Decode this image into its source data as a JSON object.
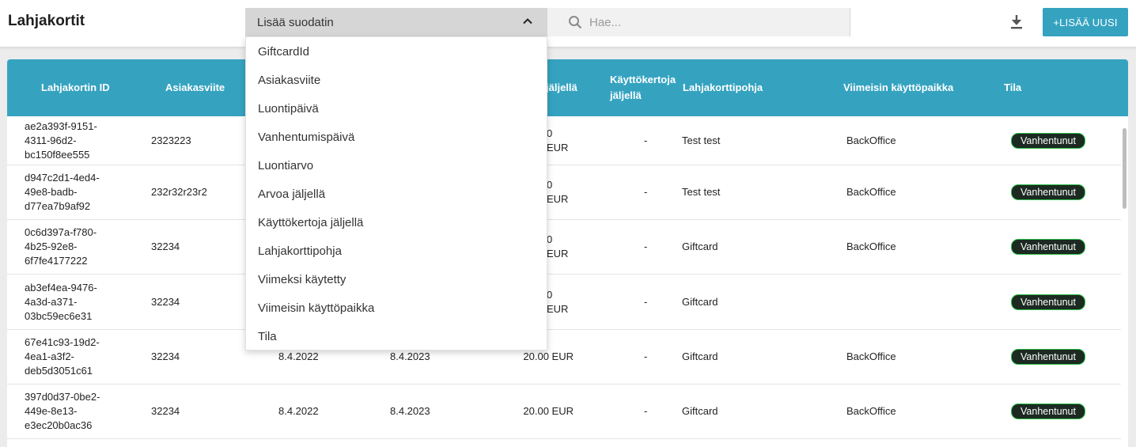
{
  "header": {
    "title": "Lahjakortit",
    "filter_label": "Lisää suodatin",
    "search_placeholder": "Hae...",
    "add_button": "+LISÄÄ UUSI"
  },
  "table": {
    "columns": [
      "Lahjakortin ID",
      "Asiakasviite",
      "",
      "",
      "jäljellä",
      "Käyttökertoja jäljellä",
      "Lahjakorttipohja",
      "Viimeisin käyttöpaikka",
      "Tila"
    ],
    "rows": [
      {
        "id": [
          "ae2a393f-9151-",
          "4311-96d2-",
          "bc150f8ee555"
        ],
        "ref": "2323223",
        "created": "",
        "expires": "",
        "value": "0 EUR",
        "uses": "-",
        "template": "Test test",
        "place": "BackOffice",
        "status": "Vanhentunut"
      },
      {
        "id": [
          "d947c2d1-4ed4-",
          "49e8-badb-",
          "d77ea7b9af92"
        ],
        "ref": "232r32r23r2",
        "created": "",
        "expires": "",
        "value": "0 EUR",
        "uses": "-",
        "template": "Test test",
        "place": "BackOffice",
        "status": "Vanhentunut"
      },
      {
        "id": [
          "0c6d397a-f780-",
          "4b25-92e8-",
          "6f7fe4177222"
        ],
        "ref": "32234",
        "created": "",
        "expires": "",
        "value": "0 EUR",
        "uses": "-",
        "template": "Giftcard",
        "place": "BackOffice",
        "status": "Vanhentunut"
      },
      {
        "id": [
          "ab3ef4ea-9476-",
          "4a3d-a371-",
          "03bc59ec6e31"
        ],
        "ref": "32234",
        "created": "",
        "expires": "",
        "value": "0 EUR",
        "uses": "-",
        "template": "Giftcard",
        "place": "",
        "status": "Vanhentunut"
      },
      {
        "id": [
          "67e41c93-19d2-",
          "4ea1-a3f2-",
          "deb5d3051c61"
        ],
        "ref": "32234",
        "created": "8.4.2022",
        "expires": "8.4.2023",
        "value": "20.00 EUR",
        "uses": "-",
        "template": "Giftcard",
        "place": "BackOffice",
        "status": "Vanhentunut"
      },
      {
        "id": [
          "397d0d37-0be2-",
          "449e-8e13-",
          "e3ec20b0ac36"
        ],
        "ref": "32234",
        "created": "8.4.2022",
        "expires": "8.4.2023",
        "value": "20.00 EUR",
        "uses": "-",
        "template": "Giftcard",
        "place": "BackOffice",
        "status": "Vanhentunut"
      }
    ]
  },
  "dropdown": {
    "items": [
      "GiftcardId",
      "Asiakasviite",
      "Luontipäivä",
      "Vanhentumispäivä",
      "Luontiarvo",
      "Arvoa jäljellä",
      "Käyttökertoja jäljellä",
      "Lahjakorttipohja",
      "Viimeksi käytetty",
      "Viimeisin käyttöpaikka",
      "Tila"
    ]
  },
  "colors": {
    "accent": "#35a3c0",
    "badge_bg": "#1c2a22",
    "badge_border": "#2fbf4a"
  },
  "icons": {
    "chevron": "chevron-up-icon",
    "search": "search-icon",
    "download": "download-icon"
  }
}
